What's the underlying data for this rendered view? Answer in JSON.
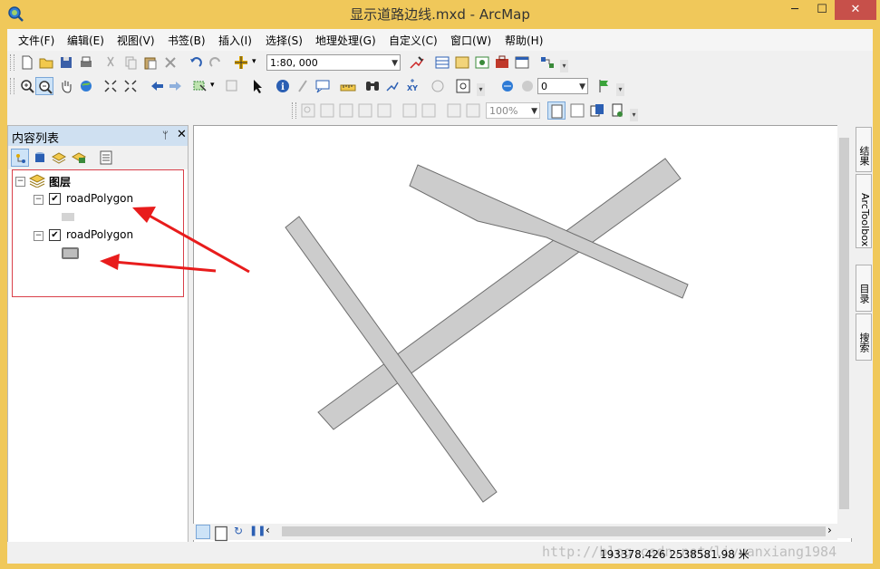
{
  "window": {
    "title": "显示道路边线.mxd - ArcMap",
    "minimize": "─",
    "maximize": "☐",
    "close": "✕"
  },
  "menu": [
    "文件(F)",
    "编辑(E)",
    "视图(V)",
    "书签(B)",
    "插入(I)",
    "选择(S)",
    "地理处理(G)",
    "自定义(C)",
    "窗口(W)",
    "帮助(H)"
  ],
  "toolbar": {
    "scale": "1:80, 000",
    "value_field": "0",
    "zoom_percent": "100%"
  },
  "toc": {
    "title": "内容列表",
    "pin": "ᛘ",
    "close": "✕",
    "root_layer": "图层",
    "layers": [
      {
        "name": "roadPolygon",
        "checked": "✔"
      },
      {
        "name": "roadPolygon",
        "checked": "✔"
      }
    ]
  },
  "right_dock": {
    "tabs": [
      "结果",
      "ArcToolbox",
      "目录",
      "搜索"
    ]
  },
  "status": {
    "coordinates": "193378.426  2538581.98 米",
    "watermark": "http://blog.csdn.net/liyuanxiang1984"
  },
  "colors": {
    "road_fill": "#cccccc",
    "road_stroke": "#6e6e6e",
    "annotation_red": "#e81c1c",
    "title_bar": "#f0c85a"
  }
}
